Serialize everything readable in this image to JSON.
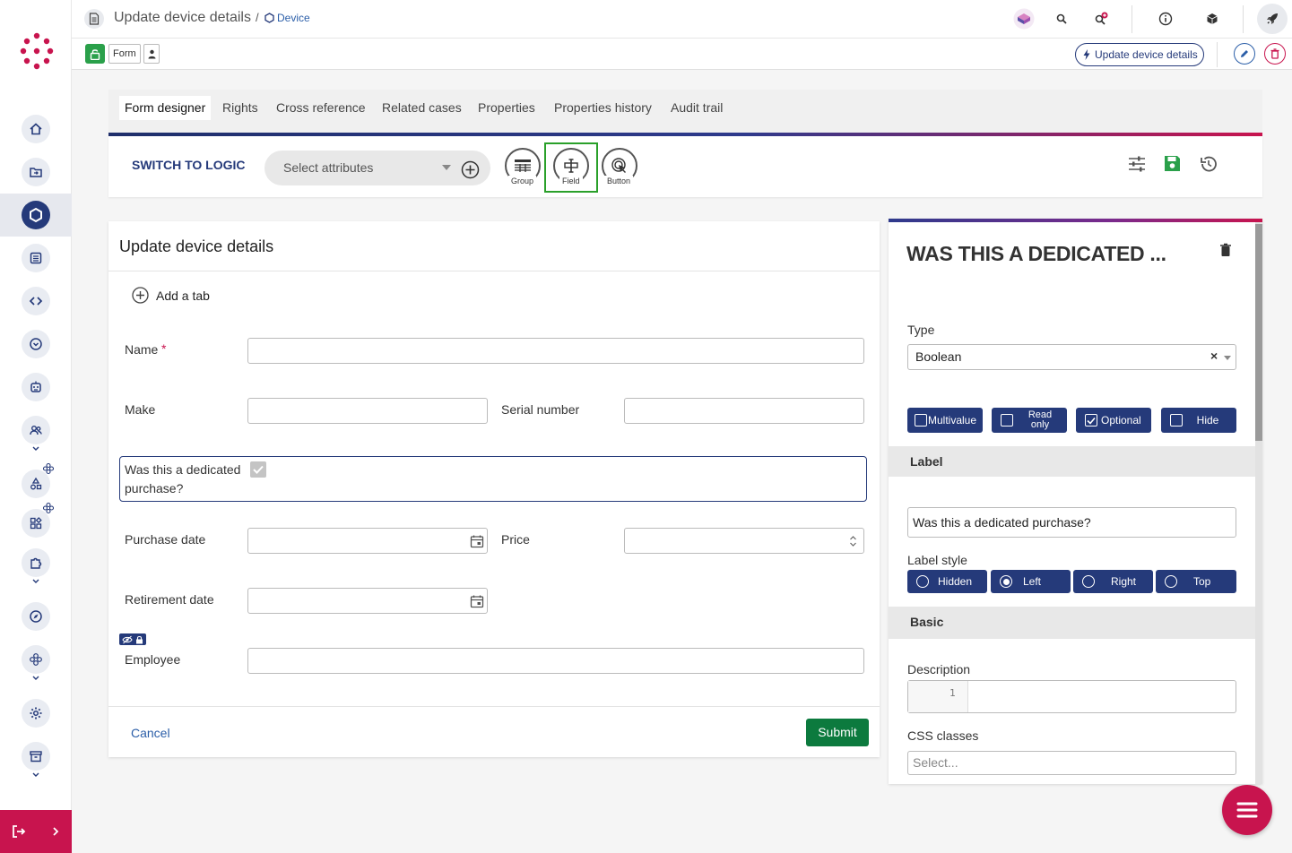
{
  "header": {
    "title": "Update device details",
    "separator": "/",
    "breadcrumb_device": "Device",
    "form_chip": "Form",
    "update_button": "Update device details"
  },
  "tabs": [
    "Form designer",
    "Rights",
    "Cross reference",
    "Related cases",
    "Properties",
    "Properties history",
    "Audit trail"
  ],
  "toolbar": {
    "switch_to_logic": "SWITCH TO LOGIC",
    "select_placeholder": "Select attributes",
    "group_label": "Group",
    "field_label": "Field",
    "button_label": "Button"
  },
  "form": {
    "title": "Update device details",
    "add_tab": "Add a tab",
    "name_label": "Name",
    "required_mark": "*",
    "make_label": "Make",
    "serial_label": "Serial number",
    "dedicated_label_line1": "Was this a dedicated",
    "dedicated_label_line2": "purchase?",
    "purchase_date_label": "Purchase date",
    "price_label": "Price",
    "retirement_label": "Retirement date",
    "employee_label": "Employee",
    "cancel": "Cancel",
    "submit": "Submit"
  },
  "panel": {
    "title": "WAS THIS A DEDICATED ...",
    "type_label": "Type",
    "type_value": "Boolean",
    "type_clear": "×",
    "options": [
      {
        "label": "Multivalue",
        "checked": false
      },
      {
        "label": "Read only",
        "checked": false
      },
      {
        "label": "Optional",
        "checked": true
      },
      {
        "label": "Hide",
        "checked": false
      }
    ],
    "label_section": "Label",
    "label_value": "Was this a dedicated purchase?",
    "label_style_label": "Label style",
    "label_styles": [
      {
        "label": "Hidden",
        "selected": false
      },
      {
        "label": "Left",
        "selected": true
      },
      {
        "label": "Right",
        "selected": false
      },
      {
        "label": "Top",
        "selected": false
      }
    ],
    "basic_section": "Basic",
    "description_label": "Description",
    "description_line_no": "1",
    "css_label": "CSS classes",
    "css_placeholder": "Select..."
  },
  "colors": {
    "brand": "#c8144e",
    "navy": "#253a7a",
    "success": "#0c7a3e"
  }
}
